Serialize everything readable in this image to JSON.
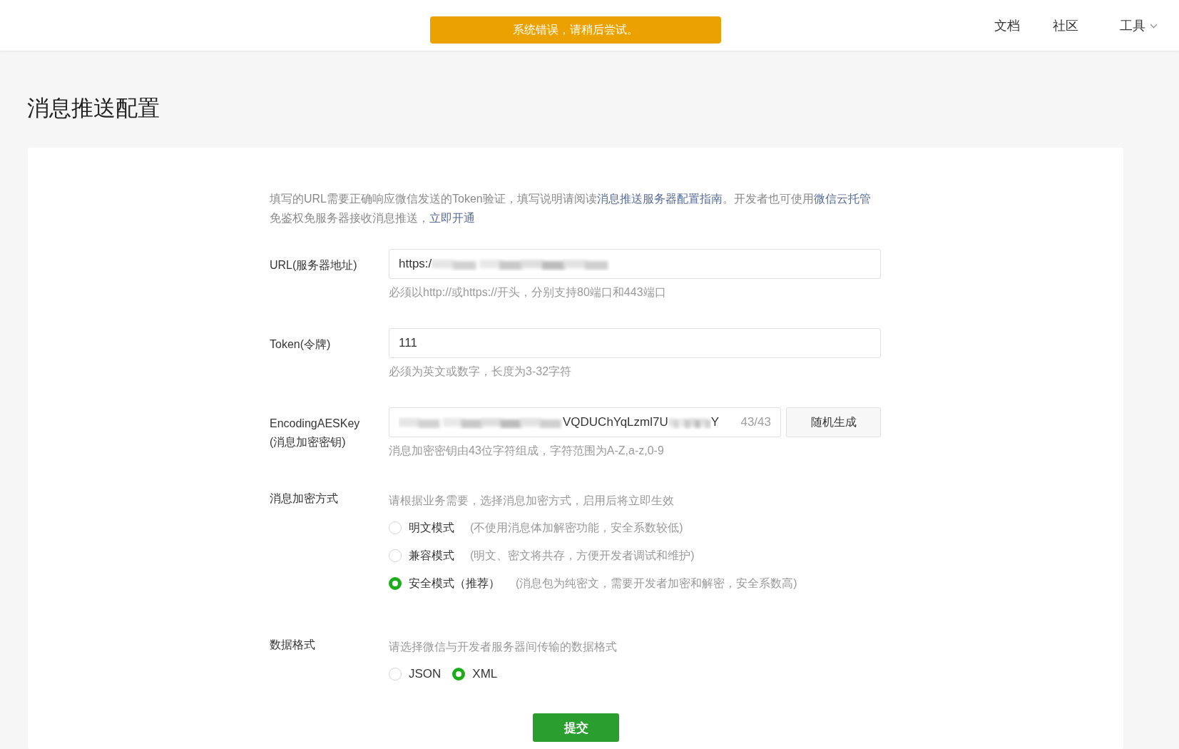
{
  "header": {
    "toast": "系统错误，请稍后尝试。",
    "nav": [
      {
        "label": "文档",
        "kind": "link"
      },
      {
        "label": "社区",
        "kind": "link"
      },
      {
        "label": "工具",
        "kind": "menu"
      }
    ]
  },
  "page_title": "消息推送配置",
  "intro": [
    {
      "kind": "text",
      "text": "填写的URL需要正确响应微信发送的Token验证，填写说明请阅读"
    },
    {
      "kind": "link",
      "text": "消息推送服务器配置指南"
    },
    {
      "kind": "text",
      "text": "。开发者也可使用"
    },
    {
      "kind": "link",
      "text": "微信云托管"
    },
    {
      "kind": "text",
      "text": "免鉴权免服务器接收消息推送，"
    },
    {
      "kind": "link",
      "text": "立即开通"
    }
  ],
  "fields": [
    {
      "kind": "text",
      "label": "URL(服务器地址)",
      "value": "https:/",
      "redacted": true,
      "hint": "必须以http://或https://开头，分别支持80端口和443端口"
    },
    {
      "kind": "text",
      "label": "Token(令牌)",
      "value": "111",
      "redacted": false,
      "hint": "必须为英文或数字，长度为3-32字符"
    },
    {
      "kind": "key",
      "label": "EncodingAESKey (消息加密密钥)",
      "value": "VQDUChYqLzml7U",
      "value_end": "Y",
      "redacted": true,
      "count": "43/43",
      "button": "随机生成",
      "hint": "消息加密密钥由43位字符组成，字符范围为A-Z,a-z,0-9"
    },
    {
      "kind": "radio",
      "label": "消息加密方式",
      "hint": "请根据业务需要，选择消息加密方式，启用后将立即生效",
      "options": [
        {
          "label": "明文模式",
          "note": "(不使用消息体加解密功能，安全系数较低)",
          "selected": false
        },
        {
          "label": "兼容模式",
          "note": "(明文、密文将共存，方便开发者调试和维护)",
          "selected": false
        },
        {
          "label": "安全模式（推荐）",
          "note": "(消息包为纯密文，需要开发者加密和解密，安全系数高)",
          "selected": true
        }
      ]
    },
    {
      "kind": "radio_inline",
      "label": "数据格式",
      "hint": "请选择微信与开发者服务器间传输的数据格式",
      "options": [
        {
          "label": "JSON",
          "selected": false
        },
        {
          "label": "XML",
          "selected": true
        }
      ]
    }
  ],
  "submit": "提交"
}
